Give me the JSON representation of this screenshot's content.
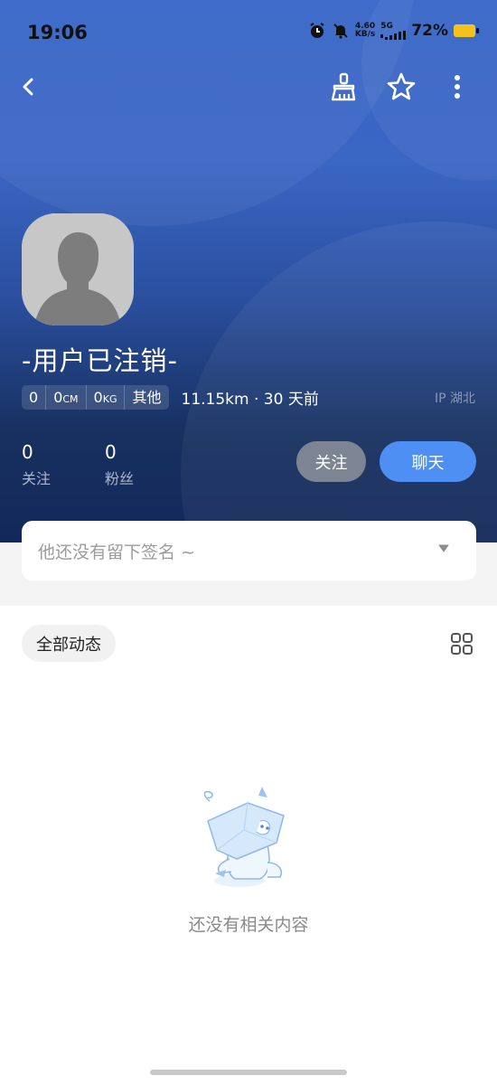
{
  "status_bar": {
    "time": "19:06",
    "net_speed_value": "4.60",
    "net_speed_unit": "KB/s",
    "network_gen": "5G",
    "battery_percent": "72%",
    "battery_color": "#f4c21b"
  },
  "nav": {
    "back_icon": "chevron-left-icon",
    "clean_icon": "broom-icon",
    "favorite_icon": "star-outline-icon",
    "more_icon": "more-vertical-icon"
  },
  "profile": {
    "username": "-用户已注销-",
    "tags": [
      {
        "value": "0",
        "unit": ""
      },
      {
        "value": "0",
        "unit": "CM"
      },
      {
        "value": "0",
        "unit": "KG"
      },
      {
        "value": "其他",
        "unit": ""
      }
    ],
    "distance": "11.15km · 30 天前",
    "ip_region": "IP 湖北",
    "following": {
      "count": "0",
      "label": "关注"
    },
    "followers": {
      "count": "0",
      "label": "粉丝"
    },
    "follow_button": "关注",
    "chat_button": "聊天"
  },
  "signature": {
    "placeholder": "他还没有留下签名 ~"
  },
  "feed": {
    "tab_label": "全部动态",
    "empty_text": "还没有相关内容"
  },
  "colors": {
    "accent": "#4d8ff2",
    "follow_button_bg": "#7d8595",
    "hero_top": "#3565c8",
    "hero_bottom": "#13285a"
  }
}
